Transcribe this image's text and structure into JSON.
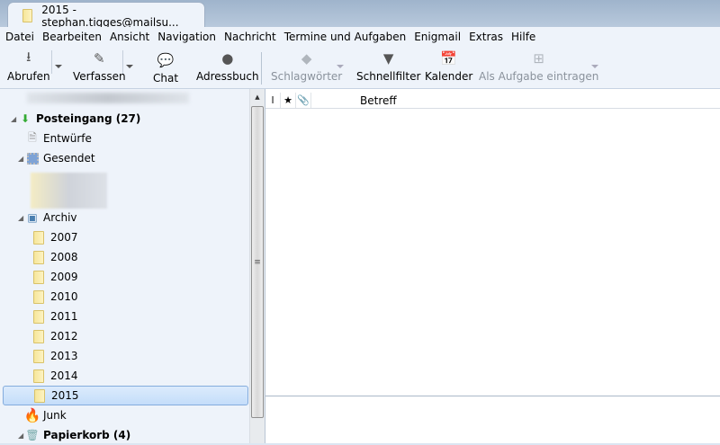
{
  "window": {
    "tab_title": "2015 - stephan.tigges@mailsu..."
  },
  "menu": [
    "Datei",
    "Bearbeiten",
    "Ansicht",
    "Navigation",
    "Nachricht",
    "Termine und Aufgaben",
    "Enigmail",
    "Extras",
    "Hilfe"
  ],
  "toolbar": {
    "abrufen": "Abrufen",
    "verfassen": "Verfassen",
    "chat": "Chat",
    "adressbuch": "Adressbuch",
    "schlagwoerter": "Schlagwörter",
    "schnellfilter": "Schnellfilter",
    "kalender": "Kalender",
    "aufgabe": "Als Aufgabe eintragen"
  },
  "folders": {
    "posteingang": "Posteingang (27)",
    "entwuerfe": "Entwürfe",
    "gesendet": "Gesendet",
    "archiv": "Archiv",
    "years": [
      "2007",
      "2008",
      "2009",
      "2010",
      "2011",
      "2012",
      "2013",
      "2014",
      "2015"
    ],
    "junk": "Junk",
    "papierkorb": "Papierkorb (4)"
  },
  "thread_list": {
    "subject_header": "Betreff"
  }
}
